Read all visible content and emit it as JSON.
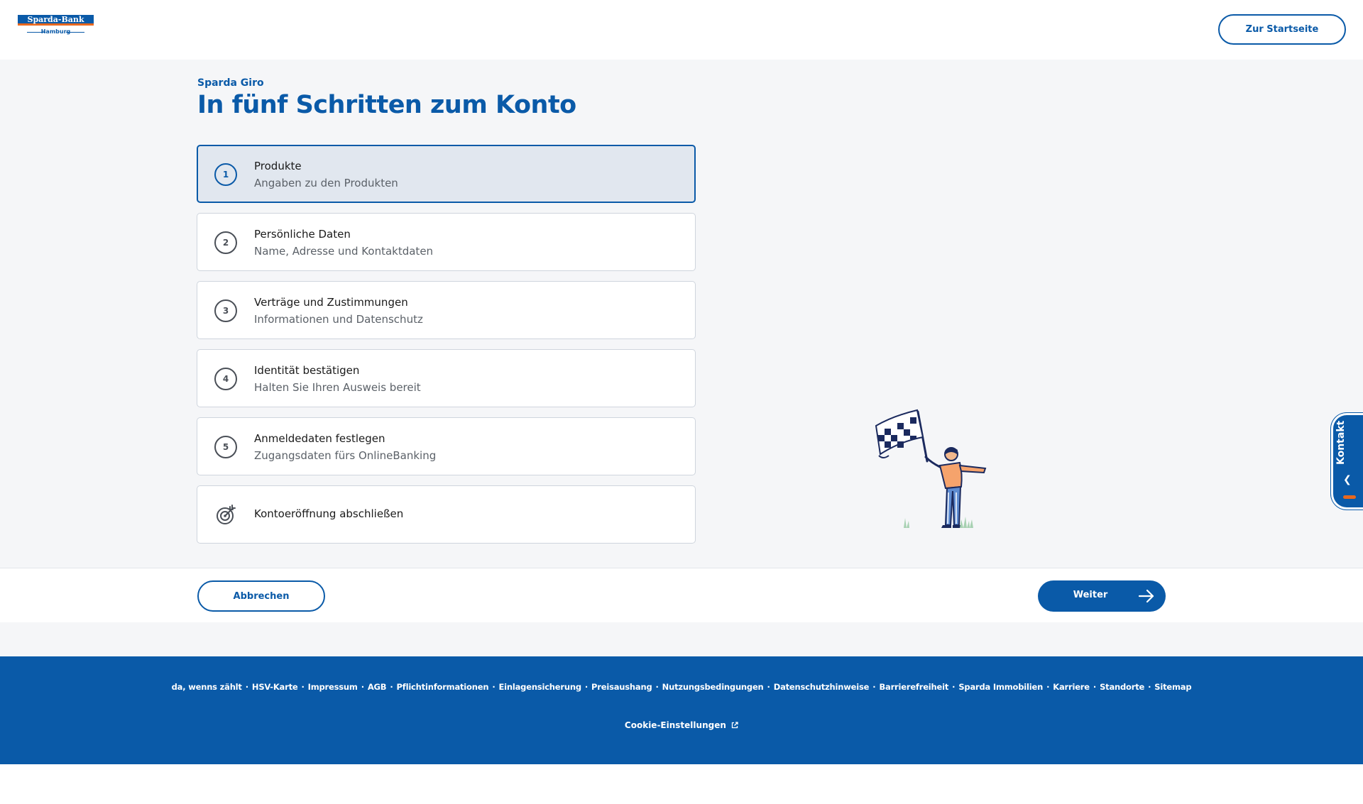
{
  "header": {
    "logo_text": "Sparda-Bank",
    "logo_sub": "Hamburg",
    "home_button": "Zur Startseite"
  },
  "main": {
    "overline": "Sparda Giro",
    "title": "In fünf Schritten zum Konto",
    "steps": [
      {
        "number": "1",
        "title": "Produkte",
        "subtitle": "Angaben zu den Produkten",
        "active": true
      },
      {
        "number": "2",
        "title": "Persönliche Daten",
        "subtitle": "Name, Adresse und Kontaktdaten",
        "active": false
      },
      {
        "number": "3",
        "title": "Verträge und Zustimmungen",
        "subtitle": "Informationen und Datenschutz",
        "active": false
      },
      {
        "number": "4",
        "title": "Identität bestätigen",
        "subtitle": "Halten Sie Ihren Ausweis bereit",
        "active": false
      },
      {
        "number": "5",
        "title": "Anmeldedaten festlegen",
        "subtitle": "Zugangsdaten fürs OnlineBanking",
        "active": false
      }
    ],
    "final_step": {
      "title": "Kontoeröffnung abschließen",
      "icon": "target-icon"
    }
  },
  "kontakt": {
    "label": "Kontakt",
    "icon": "chevron-left-icon"
  },
  "actions": {
    "cancel": "Abbrechen",
    "next": "Weiter",
    "next_icon": "arrow-right-icon"
  },
  "footer": {
    "links": [
      "da, wenns zählt",
      "HSV-Karte",
      "Impressum",
      "AGB",
      "Pflichtinformationen",
      "Einlagensicherung",
      "Preisaushang",
      "Nutzungsbedingungen",
      "Datenschutzhinweise",
      "Barrierefreiheit",
      "Sparda Immobilien",
      "Karriere",
      "Standorte",
      "Sitemap"
    ],
    "separator": "·",
    "cookie": "Cookie-Einstellungen"
  },
  "colors": {
    "brand_blue": "#0a5aa8",
    "accent_orange": "#e8681e",
    "background": "#f5f6f8"
  }
}
